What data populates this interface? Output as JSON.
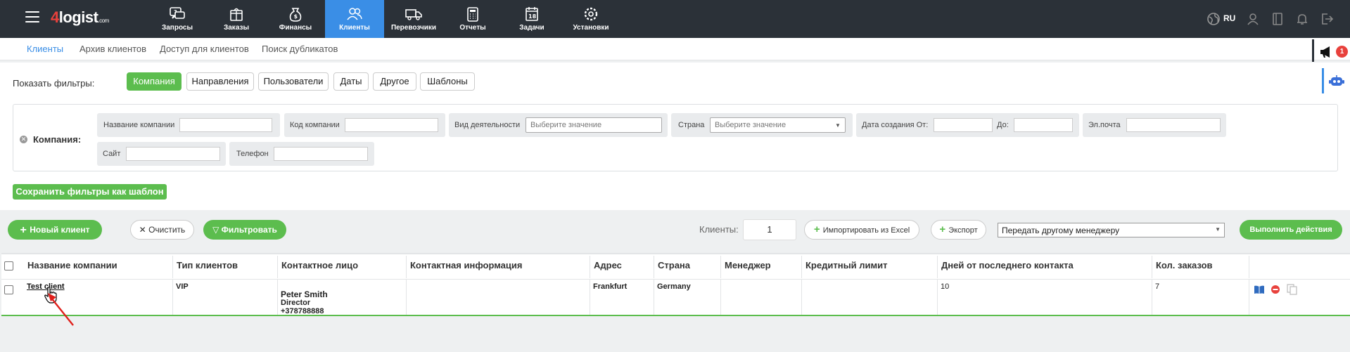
{
  "app": {
    "logo_num": "4",
    "logo_text": "logist",
    "logo_suffix": ".com"
  },
  "nav": [
    {
      "label": "Запросы",
      "icon": "chat-question-icon"
    },
    {
      "label": "Заказы",
      "icon": "package-icon"
    },
    {
      "label": "Финансы",
      "icon": "money-bag-icon"
    },
    {
      "label": "Клиенты",
      "icon": "users-icon",
      "active": true
    },
    {
      "label": "Перевозчики",
      "icon": "truck-icon"
    },
    {
      "label": "Отчеты",
      "icon": "calculator-icon"
    },
    {
      "label": "Задачи",
      "icon": "calendar-icon",
      "date": "18"
    },
    {
      "label": "Установки",
      "icon": "gear-icon"
    }
  ],
  "topright": {
    "lang": "RU"
  },
  "subnav": [
    "Клиенты",
    "Архив клиентов",
    "Доступ для клиентов",
    "Поиск дубликатов"
  ],
  "notifications": {
    "count": "1"
  },
  "filters": {
    "show_label": "Показать фильтры:",
    "tabs": [
      "Компания",
      "Направления",
      "Пользователи",
      "Даты",
      "Другое",
      "Шаблоны"
    ],
    "section_label": "Компания:",
    "fields": {
      "company_name": "Название компании",
      "company_code": "Код компании",
      "activity": "Вид деятельности",
      "activity_placeholder": "Выберите значение",
      "country": "Страна",
      "country_placeholder": "Выберите значение",
      "created_from": "Дата создания От:",
      "created_to": "До:",
      "email": "Эл.почта",
      "site": "Сайт",
      "phone": "Телефон"
    },
    "save_template": "Сохранить фильтры как шаблон"
  },
  "actions": {
    "new_client": "Новый клиент",
    "clear": "Очистить",
    "filter": "Фильтровать",
    "clients_label": "Клиенты:",
    "clients_count": "1",
    "import_excel": "Импортировать из Excel",
    "export": "Экспорт",
    "manager_select": "Передать другому менеджеру",
    "execute": "Выполнить действия"
  },
  "table": {
    "headers": [
      "Название компании",
      "Тип клиентов",
      "Контактное лицо",
      "Контактная информация",
      "Адрес",
      "Страна",
      "Менеджер",
      "Кредитный лимит",
      "Дней от последнего контакта",
      "Кол. заказов"
    ],
    "rows": [
      {
        "name": "Test client",
        "type": "VIP",
        "contact_name": "Peter Smith",
        "contact_role": "Director",
        "contact_phone": "+378788888",
        "contact_info": "",
        "address": "Frankfurt",
        "country": "Germany",
        "manager": "",
        "credit": "",
        "days": "10",
        "orders": "7"
      }
    ]
  },
  "colors": {
    "topbar": "#2b3138",
    "accent": "#3a8ee6",
    "green": "#5cbd4e",
    "red": "#e8413c"
  }
}
